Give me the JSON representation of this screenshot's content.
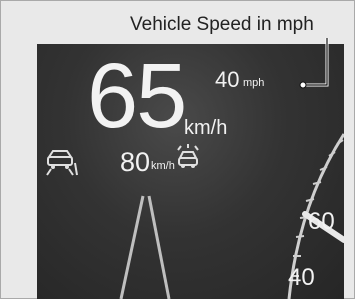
{
  "callout": {
    "label": "Vehicle Speed in mph"
  },
  "display": {
    "speed_kmh": "65",
    "speed_kmh_unit": "km/h",
    "speed_mph": "40",
    "speed_mph_unit": "mph",
    "set_speed": "80",
    "set_speed_unit": "km/h",
    "left_icon": "lane-departure-icon",
    "right_icon": "adaptive-cruise-icon"
  },
  "gauge": {
    "tick_labels": [
      "60",
      "40"
    ]
  },
  "colors": {
    "panel": "#333333",
    "text": "#f2f2f2",
    "frame_bg": "#e9e9e9"
  }
}
